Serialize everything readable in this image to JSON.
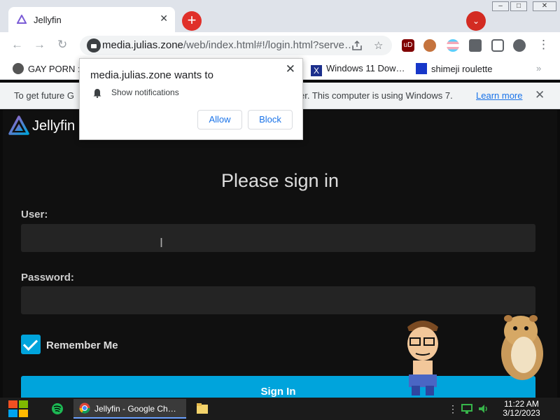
{
  "window": {
    "minimize": "–",
    "maximize": "□",
    "close": "✕"
  },
  "tab": {
    "title": "Jellyfin",
    "close": "✕",
    "new_tab": "+",
    "tab_search": "⌄"
  },
  "toolbar": {
    "back": "←",
    "forward": "→",
    "reload": "↻",
    "url_host": "media.julias.zone",
    "url_path": "/web/index.html#!/login.html?serve…",
    "share_icon": "share-icon",
    "star": "☆",
    "menu": "⋮"
  },
  "bookmarks": {
    "items": [
      {
        "label": "GAY PORN :"
      },
      {
        "label": "Windows 11 Dow…"
      },
      {
        "label": "shimeji roulette"
      }
    ],
    "overflow": "»"
  },
  "infobar": {
    "text_left": "To get future G",
    "text_right": "er. This computer is using Windows 7.",
    "learn_more": "Learn more",
    "close": "✕"
  },
  "notification_popup": {
    "title": "media.julias.zone wants to",
    "permission": "Show notifications",
    "allow": "Allow",
    "block": "Block",
    "close": "✕"
  },
  "jellyfin": {
    "brand": "Jellyfin",
    "heading": "Please sign in",
    "user_label": "User:",
    "user_value": "",
    "password_label": "Password:",
    "password_value": "",
    "remember_me": "Remember Me",
    "remember_checked": true,
    "sign_in": "Sign In",
    "accent_color": "#00a4dc"
  },
  "taskbar": {
    "chrome_label": "Jellyfin - Google Ch…",
    "time": "11:22 AM",
    "date": "3/12/2023"
  }
}
